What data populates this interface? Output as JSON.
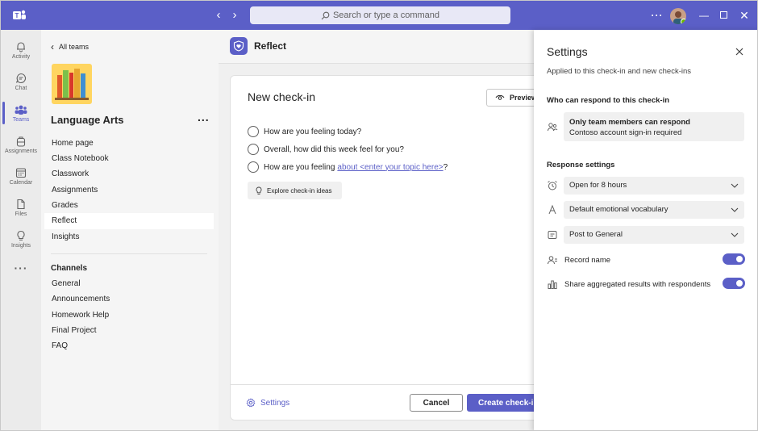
{
  "titlebar": {
    "search_placeholder": "Search or type a command"
  },
  "rail": {
    "items": [
      {
        "label": "Activity",
        "icon": "bell-icon"
      },
      {
        "label": "Chat",
        "icon": "chat-icon"
      },
      {
        "label": "Teams",
        "icon": "teams-icon",
        "active": true
      },
      {
        "label": "Assignments",
        "icon": "backpack-icon"
      },
      {
        "label": "Calendar",
        "icon": "calendar-icon"
      },
      {
        "label": "Files",
        "icon": "file-icon"
      },
      {
        "label": "Insights",
        "icon": "lightbulb-icon"
      }
    ]
  },
  "team": {
    "back_label": "All teams",
    "name": "Language Arts",
    "more": "...",
    "nav": [
      "Home page",
      "Class Notebook",
      "Classwork",
      "Assignments",
      "Grades",
      "Reflect",
      "Insights"
    ],
    "selected_nav": "Reflect",
    "channels_heading": "Channels",
    "channels": [
      "General",
      "Announcements",
      "Homework Help",
      "Final Project",
      "FAQ"
    ]
  },
  "main": {
    "app_title": "Reflect",
    "card_title": "New check-in",
    "preview_label": "Preview",
    "questions": [
      {
        "text": "How are you feeling today?"
      },
      {
        "text": "Overall, how did this week feel for you?"
      },
      {
        "text": "How are you feeling",
        "link": "about <enter your topic here>",
        "suffix": "?"
      }
    ],
    "explore_label": "Explore check-in ideas",
    "settings_link": "Settings",
    "cancel_label": "Cancel",
    "create_label": "Create check-in"
  },
  "settings": {
    "title": "Settings",
    "subtitle": "Applied to this check-in and new check-ins",
    "who_heading": "Who can respond to this check-in",
    "who_line1": "Only team members can respond",
    "who_line2": "Contoso account sign-in required",
    "response_heading": "Response settings",
    "duration": "Open for 8 hours",
    "vocabulary": "Default emotional vocabulary",
    "post_to": "Post to General",
    "record_name_label": "Record name",
    "record_name_on": true,
    "share_label": "Share aggregated results with respondents",
    "share_on": true
  },
  "colors": {
    "accent": "#5b5fc7",
    "titlebar": "#5b5fc7"
  }
}
